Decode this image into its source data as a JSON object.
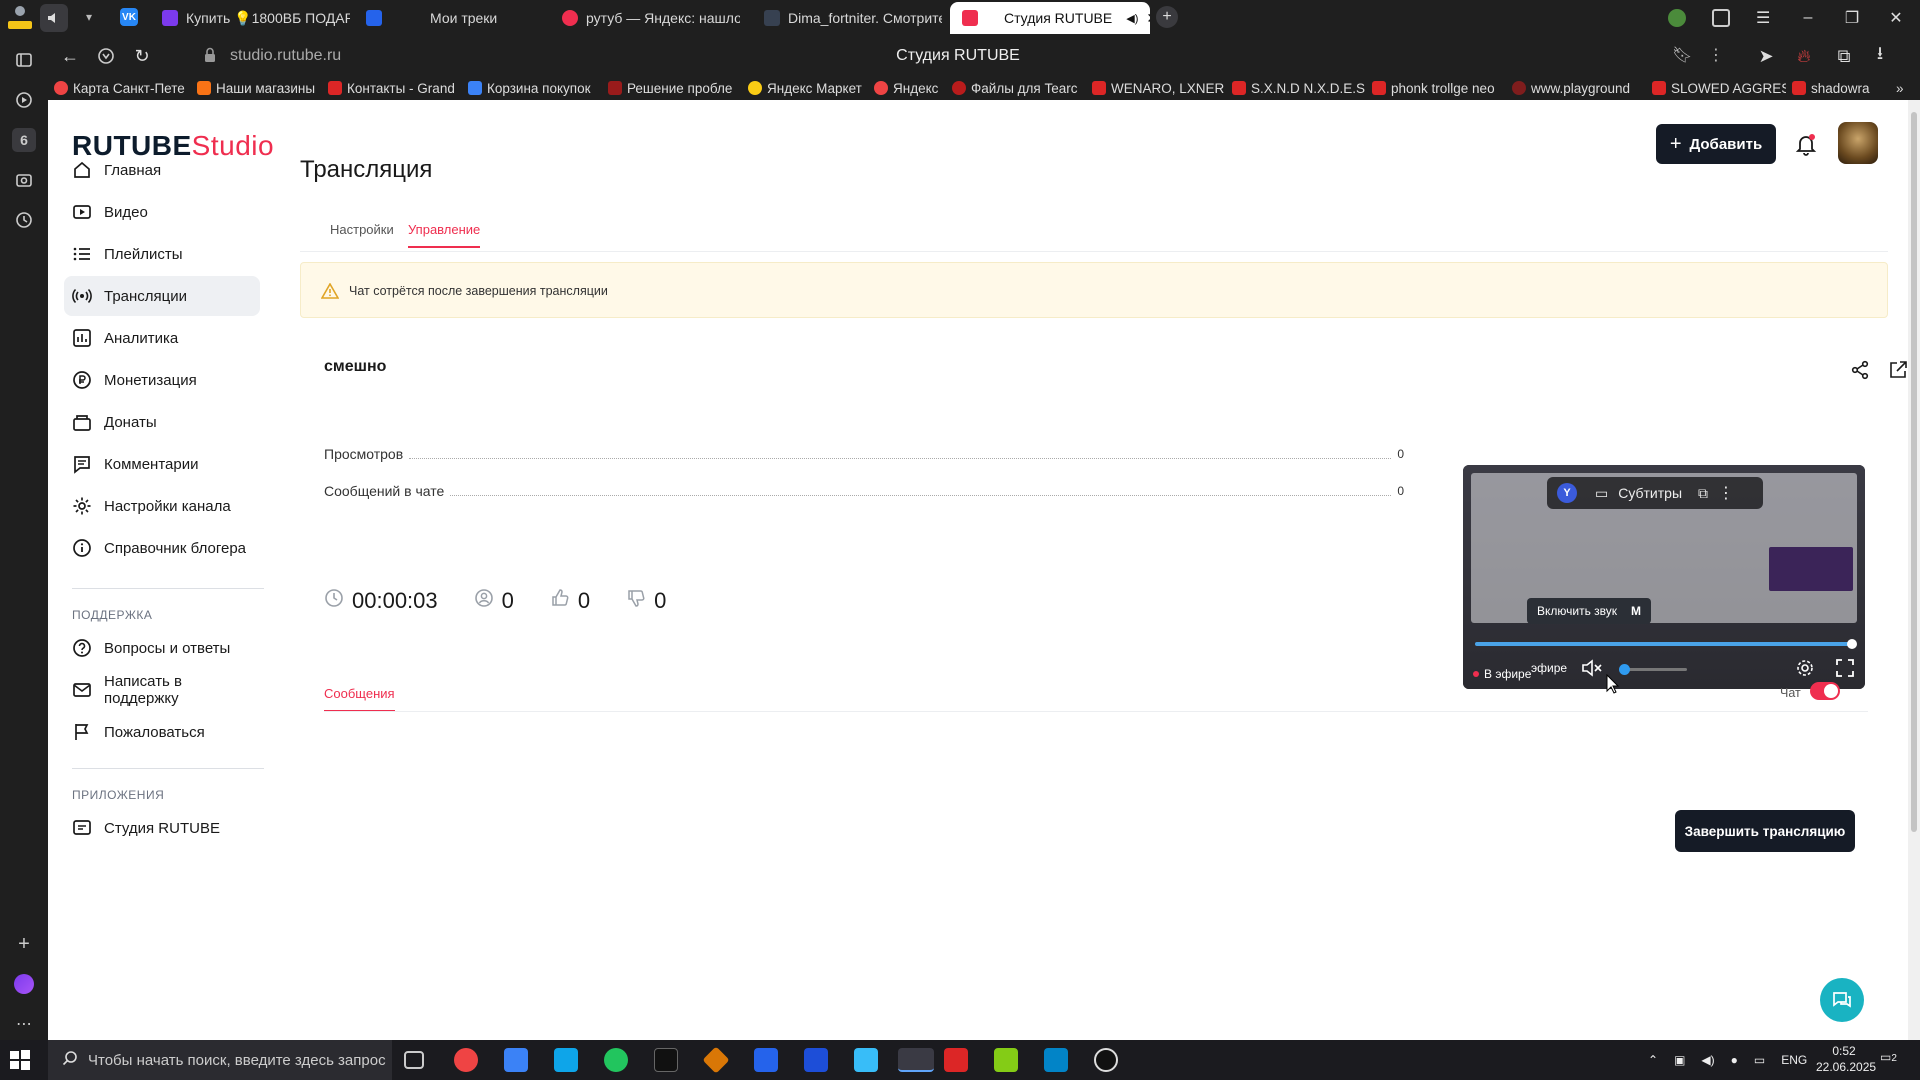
{
  "browser": {
    "tabs": [
      {
        "label": "Купить 💡1800ВБ ПОДАР",
        "color": "#7c3aed"
      },
      {
        "label": "Мои треки",
        "color": "#2563eb"
      },
      {
        "label": "рутуб — Яндекс: нашлось",
        "color": "#ef2e4f"
      },
      {
        "label": "Dima_fortniter. Смотрите",
        "color": "#1f2937"
      },
      {
        "label": "Студия RUTUBE",
        "color": "#ef2e4f"
      }
    ],
    "url": "studio.rutube.ru",
    "page_title": "Студия RUTUBE",
    "bookmarks": [
      {
        "label": "Карта Санкт-Пете",
        "color": "#ef4444"
      },
      {
        "label": "Наши магазины",
        "color": "#f97316"
      },
      {
        "label": "Контакты - Grand",
        "color": "#dc2626"
      },
      {
        "label": "Корзина покупок",
        "color": "#3b82f6"
      },
      {
        "label": "Решение пробле",
        "color": "#991b1b"
      },
      {
        "label": "Яндекс Маркет",
        "color": "#facc15"
      },
      {
        "label": "Яндекс",
        "color": "#ef4444"
      },
      {
        "label": "Файлы для Tearc",
        "color": "#b91c1c"
      },
      {
        "label": "WENARO, LXNER",
        "color": "#dc2626"
      },
      {
        "label": "S.X.N.D N.X.D.E.S",
        "color": "#dc2626"
      },
      {
        "label": "phonk trollge neo",
        "color": "#dc2626"
      },
      {
        "label": "www.playground",
        "color": "#7f1d1d"
      },
      {
        "label": "SLOWED AGGRES",
        "color": "#dc2626"
      },
      {
        "label": "shadowra",
        "color": "#dc2626"
      }
    ],
    "sidebar_badge": "6"
  },
  "header": {
    "logo_main": "RUTUBE",
    "logo_sub": "Studio",
    "add_button": "Добавить"
  },
  "nav": {
    "items": [
      {
        "label": "Главная",
        "icon": "home-icon"
      },
      {
        "label": "Видео",
        "icon": "video-icon"
      },
      {
        "label": "Плейлисты",
        "icon": "playlist-icon"
      },
      {
        "label": "Трансляции",
        "icon": "broadcast-icon"
      },
      {
        "label": "Аналитика",
        "icon": "analytics-icon"
      },
      {
        "label": "Монетизация",
        "icon": "ruble-icon"
      },
      {
        "label": "Донаты",
        "icon": "donate-icon"
      },
      {
        "label": "Комментарии",
        "icon": "comment-icon"
      },
      {
        "label": "Настройки канала",
        "icon": "gear-icon"
      },
      {
        "label": "Справочник блогера",
        "icon": "info-icon"
      }
    ],
    "support_heading": "ПОДДЕРЖКА",
    "support_items": [
      {
        "label": "Вопросы и ответы",
        "icon": "question-icon"
      },
      {
        "label": "Написать в поддержку",
        "icon": "mail-icon"
      },
      {
        "label": "Пожаловаться",
        "icon": "flag-icon"
      }
    ],
    "apps_heading": "ПРИЛОЖЕНИЯ",
    "apps_items": [
      {
        "label": "Студия RUTUBE",
        "icon": "studio-icon"
      }
    ]
  },
  "main": {
    "title": "Трансляция",
    "tabs": [
      "Настройки",
      "Управление"
    ],
    "active_tab": "Управление",
    "warning": "Чат сотрётся после завершения трансляции",
    "stream": {
      "name": "смешно",
      "stats": [
        {
          "label": "Просмотров",
          "value": "0"
        },
        {
          "label": "Сообщений в чате",
          "value": "0"
        }
      ],
      "duration": "00:00:03",
      "viewers": "0",
      "likes": "0",
      "dislikes": "0",
      "end_button": "Завершить трансляцию"
    },
    "player": {
      "subtitles": "Субтитры",
      "unmute_tooltip": "Включить звук",
      "unmute_key": "M",
      "live_label": "В эфире",
      "live_partial": "эфире",
      "progress": 1.0,
      "volume": 0.0
    },
    "messages_tab": "Сообщения",
    "chat_label": "Чат",
    "chat_enabled": true
  },
  "taskbar": {
    "search_placeholder": "Чтобы начать поиск, введите здесь запрос",
    "lang": "ENG",
    "time": "0:52",
    "date": "22.06.2025",
    "notifications": "2"
  }
}
